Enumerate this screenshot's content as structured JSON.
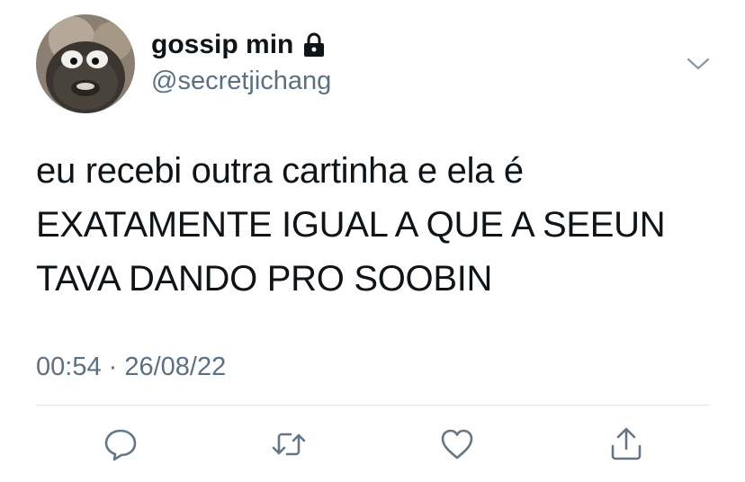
{
  "tweet": {
    "display_name": "gossip min",
    "handle": "@secretjichang",
    "protected_icon": "lock-icon",
    "menu_icon": "chevron-down-icon",
    "text_lines": [
      "eu recebi outra cartinha e ela é",
      "EXATAMENTE IGUAL A QUE A SEEUN",
      "TAVA DANDO PRO SOOBIN"
    ],
    "timestamp": "00:54 · 26/08/22"
  },
  "actions": [
    {
      "icon": "reply-icon"
    },
    {
      "icon": "retweet-icon"
    },
    {
      "icon": "like-icon"
    },
    {
      "icon": "share-icon"
    }
  ],
  "colors": {
    "text": "#0f1419",
    "secondary": "#5b7083",
    "divider": "#e1e8ed",
    "icon": "#657786"
  }
}
